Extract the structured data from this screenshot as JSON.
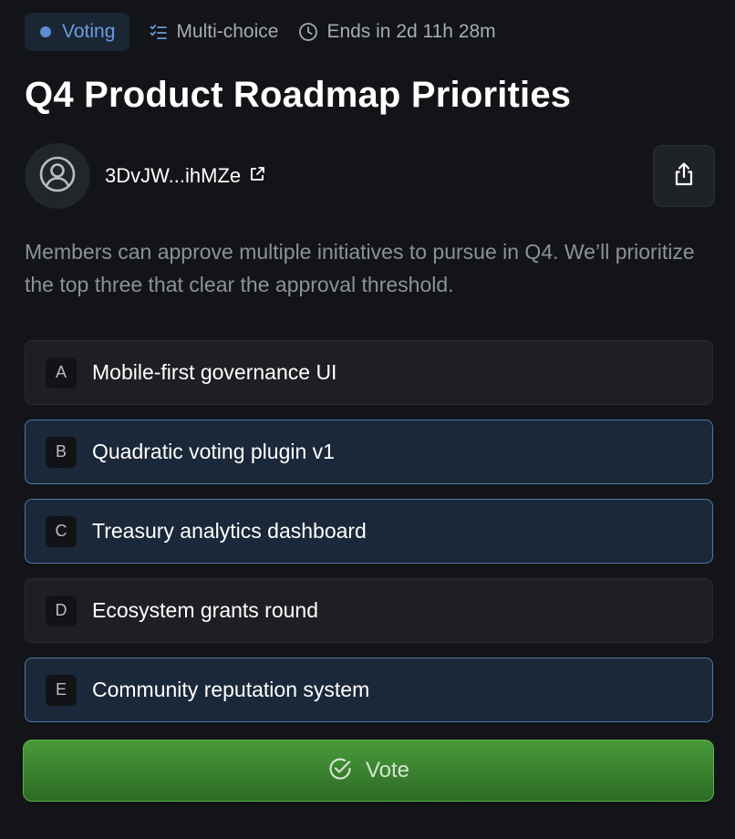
{
  "header": {
    "status": "Voting",
    "type": "Multi-choice",
    "ends": "Ends in 2d 11h 28m"
  },
  "title": "Q4 Product Roadmap Priorities",
  "author": {
    "address": "3DvJW...ihMZe"
  },
  "description": "Members can approve multiple initiatives to pursue in Q4. We’ll prioritize the top three that clear the approval threshold.",
  "options": [
    {
      "letter": "A",
      "label": "Mobile-first governance UI",
      "selected": false
    },
    {
      "letter": "B",
      "label": "Quadratic voting plugin v1",
      "selected": true
    },
    {
      "letter": "C",
      "label": "Treasury analytics dashboard",
      "selected": true
    },
    {
      "letter": "D",
      "label": "Ecosystem grants round",
      "selected": false
    },
    {
      "letter": "E",
      "label": "Community reputation system",
      "selected": true
    }
  ],
  "vote_button": {
    "label": "Vote"
  },
  "colors": {
    "background": "#121417",
    "status_accent": "#6b9be0",
    "selected_border": "#4d78a8",
    "vote_green": "#3c8530"
  },
  "icons": {
    "status": "status-dot-icon",
    "type": "checklist-icon",
    "ends": "clock-icon",
    "avatar": "user-circle-icon",
    "author_link": "external-link-icon",
    "share": "share-icon",
    "vote": "check-circle-icon"
  }
}
